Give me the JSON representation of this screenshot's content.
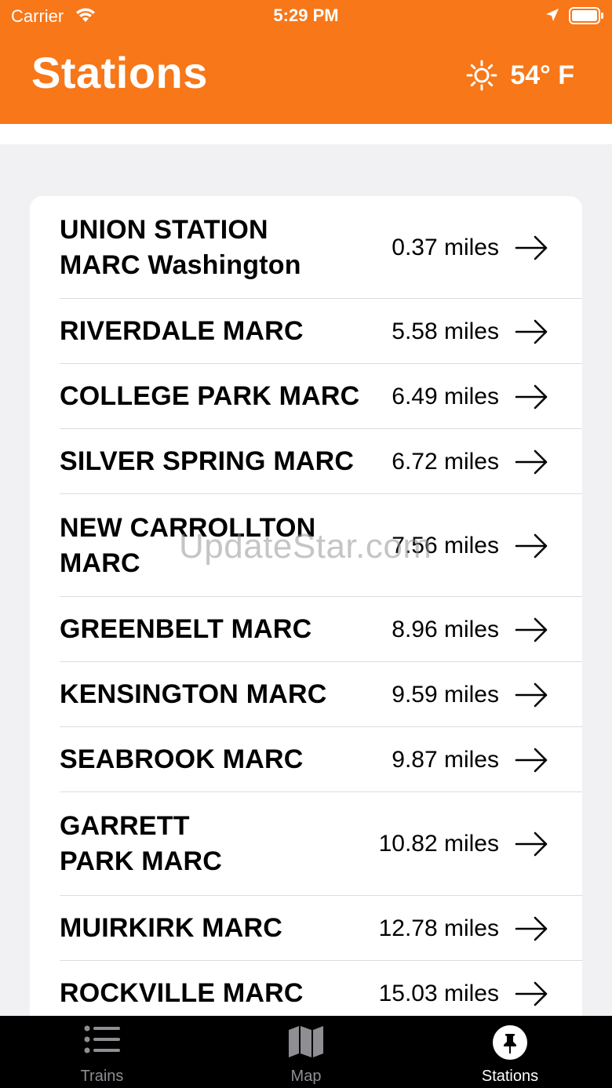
{
  "status_bar": {
    "carrier": "Carrier",
    "time": "5:29 PM"
  },
  "header": {
    "title": "Stations",
    "weather_icon": "sun-icon",
    "temperature": "54° F"
  },
  "stations": [
    {
      "name": "UNION STATION MARC Washington",
      "distance": "0.37 miles"
    },
    {
      "name": "RIVERDALE MARC",
      "distance": "5.58 miles"
    },
    {
      "name": "COLLEGE PARK MARC",
      "distance": "6.49 miles"
    },
    {
      "name": "SILVER SPRING MARC",
      "distance": "6.72 miles"
    },
    {
      "name": "NEW CARROLLTON MARC",
      "distance": "7.56 miles"
    },
    {
      "name": "GREENBELT MARC",
      "distance": "8.96 miles"
    },
    {
      "name": "KENSINGTON MARC",
      "distance": "9.59 miles"
    },
    {
      "name": "SEABROOK MARC",
      "distance": "9.87 miles"
    },
    {
      "name": "GARRETT PARK MARC",
      "distance": "10.82 miles"
    },
    {
      "name": "MUIRKIRK MARC",
      "distance": "12.78 miles"
    },
    {
      "name": "ROCKVILLE MARC",
      "distance": "15.03 miles"
    }
  ],
  "watermark": "UpdateStar.com",
  "tabs": [
    {
      "label": "Trains",
      "icon": "list-icon"
    },
    {
      "label": "Map",
      "icon": "map-icon"
    },
    {
      "label": "Stations",
      "icon": "pin-icon"
    }
  ],
  "colors": {
    "accent": "#f77719",
    "tab_active": "#ffffff",
    "tab_inactive": "#8e8e93"
  }
}
